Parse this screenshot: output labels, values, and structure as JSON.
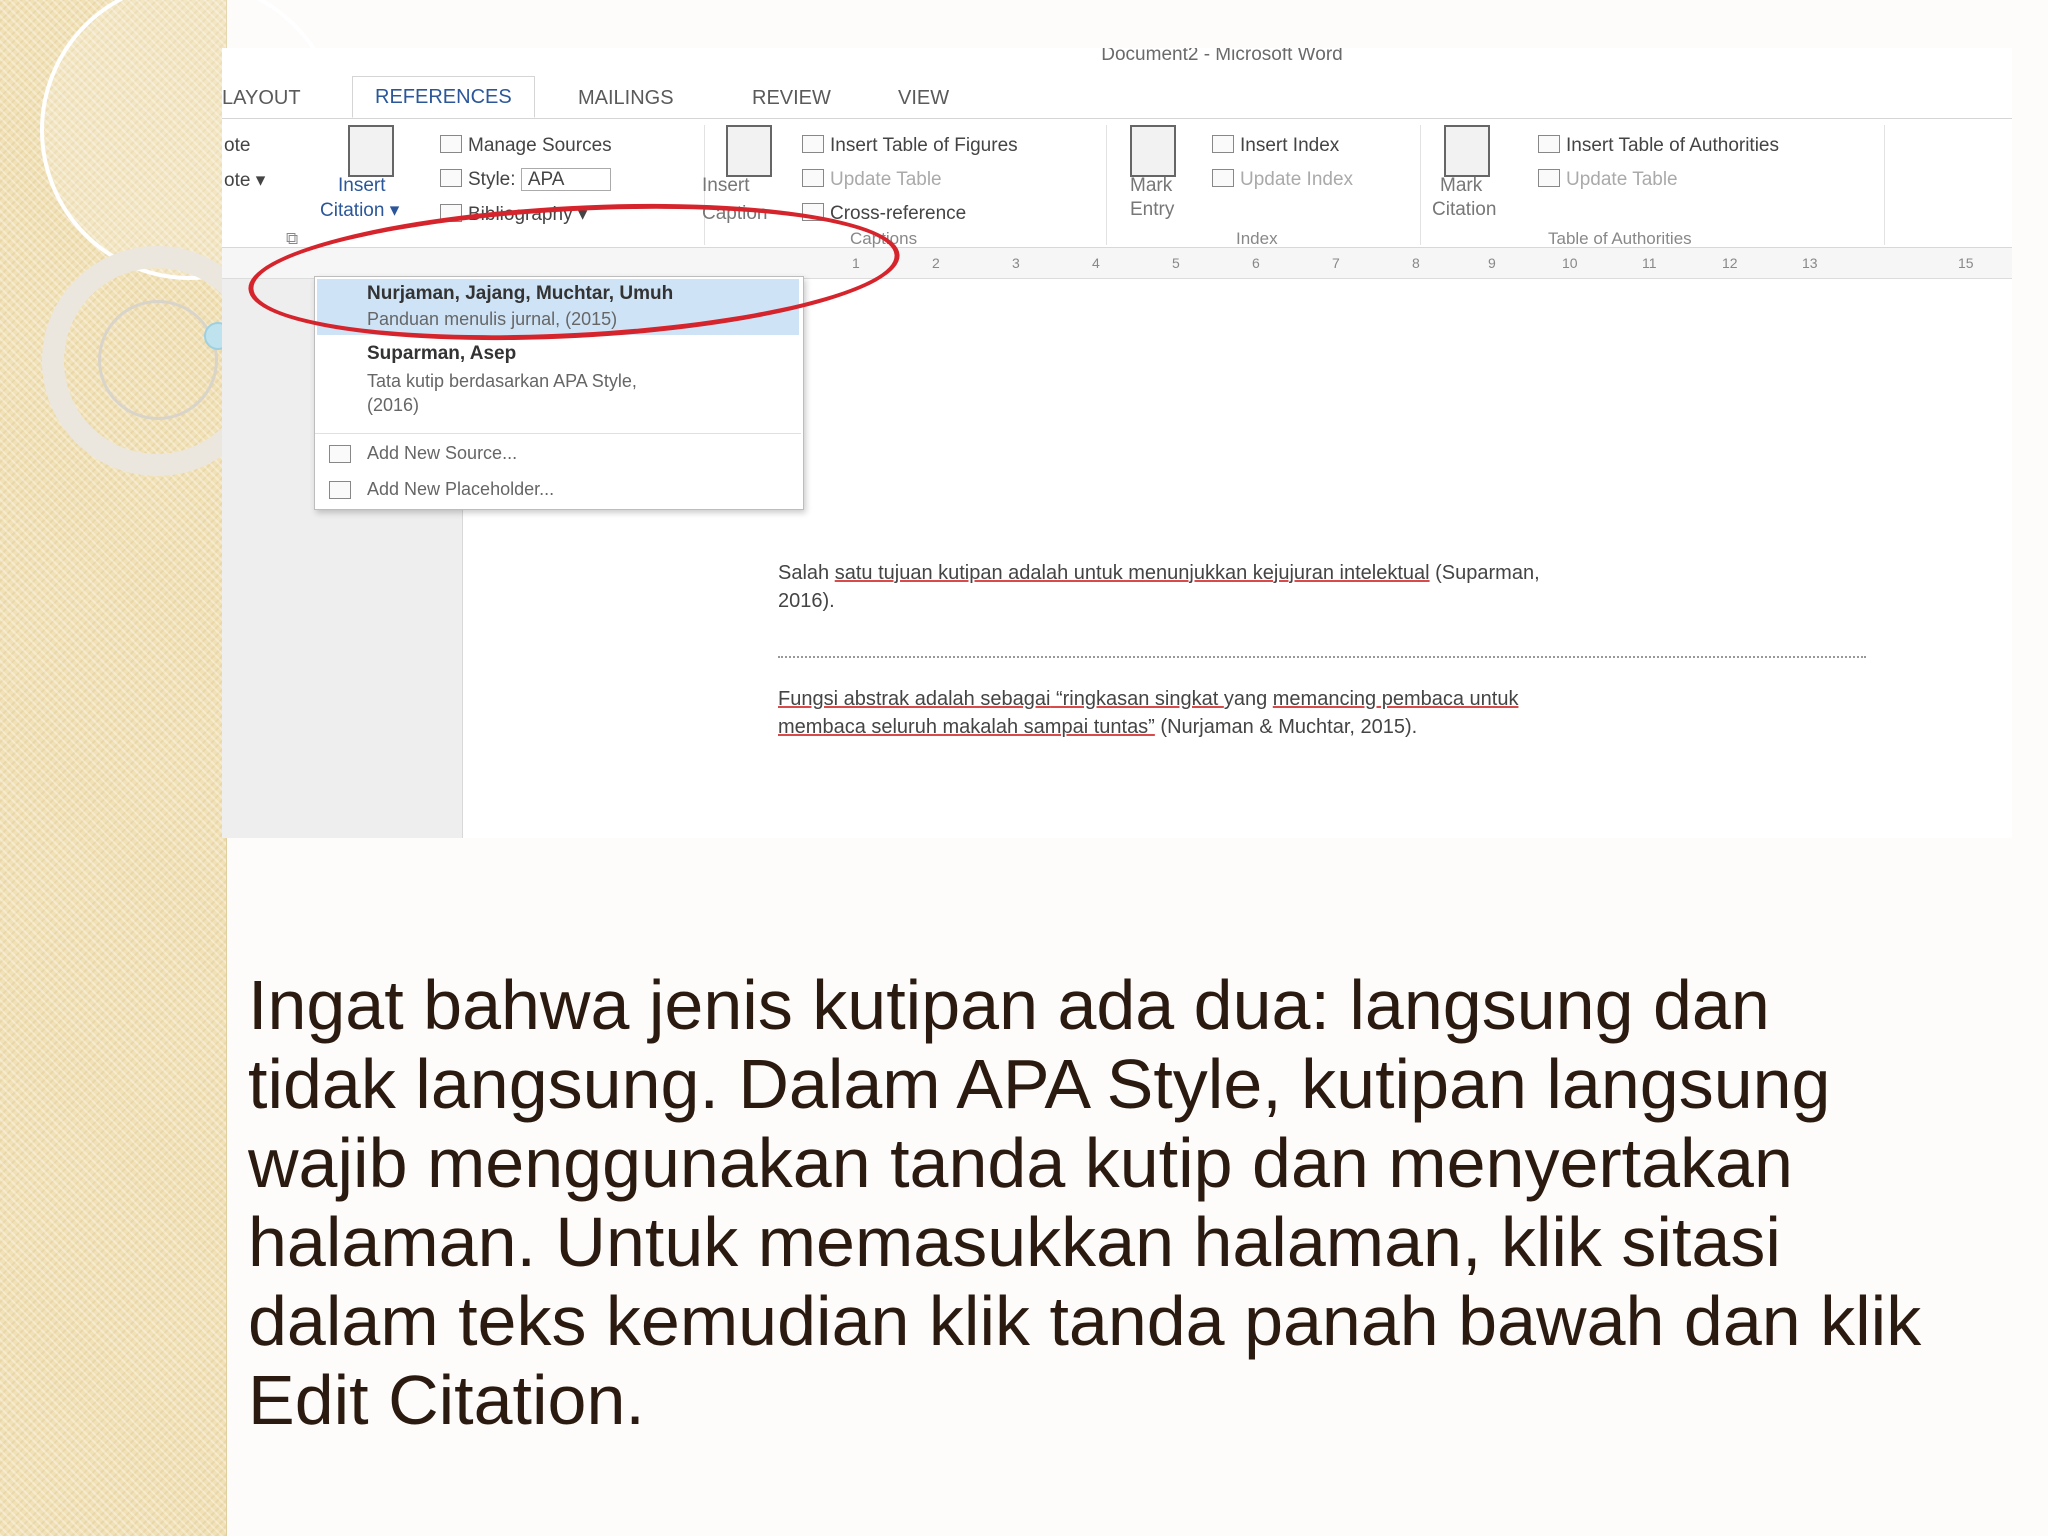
{
  "window": {
    "title": "Document2 - Microsoft Word"
  },
  "ribbon_tabs": [
    {
      "label": "LAYOUT"
    },
    {
      "label": "REFERENCES",
      "active": true
    },
    {
      "label": "MAILINGS"
    },
    {
      "label": "REVIEW"
    },
    {
      "label": "VIEW"
    }
  ],
  "ribbon": {
    "footnotes_partial": [
      "ote",
      "ote  ▾"
    ],
    "insert_citation": [
      "Insert",
      "Citation ▾"
    ],
    "manage_sources": "Manage Sources",
    "style_label": "Style:",
    "style_value": "APA",
    "bibliography": "Bibliography ▾",
    "captions": {
      "insert_caption": [
        "Insert",
        "Caption"
      ],
      "insert_table_of_figures": "Insert Table of Figures",
      "update_table": "Update Table",
      "cross_reference": "Cross-reference",
      "group_label": "Captions"
    },
    "index": {
      "mark_entry": [
        "Mark",
        "Entry"
      ],
      "insert_index": "Insert Index",
      "update_index": "Update Index",
      "group_label": "Index"
    },
    "authorities": {
      "mark_citation": [
        "Mark",
        "Citation"
      ],
      "insert_table_of_authorities": "Insert Table of Authorities",
      "update_table": "Update Table",
      "group_label": "Table of Authorities"
    }
  },
  "ruler_ticks": [
    "1",
    "2",
    "3",
    "4",
    "5",
    "6",
    "7",
    "8",
    "9",
    "10",
    "11",
    "12",
    "13",
    "15"
  ],
  "citation_menu": {
    "sources": [
      {
        "author": "Nurjaman, Jajang, Muchtar, Umuh",
        "detail": "Panduan menulis jurnal, (2015)",
        "highlighted": true
      },
      {
        "author": "Suparman, Asep",
        "detail": "Tata kutip berdasarkan APA Style,",
        "detail2": "(2016)"
      }
    ],
    "add_new_source": "Add New Source...",
    "add_new_placeholder": "Add New Placeholder..."
  },
  "document": {
    "para1_line1_a": "Salah ",
    "para1_line1_b": "satu tujuan kutipan adalah untuk menunjukkan kejujuran intelektual",
    "para1_line1_c": " (Suparman,",
    "para1_line2": "2016).",
    "para2_line1_a": "Fungsi abstrak adalah sebagai",
    "para2_line1_b": " “ringkasan singkat ",
    "para2_line1_c": "yang ",
    "para2_line1_d": "memancing pembaca untuk",
    "para2_line2_a": "membaca seluruh makalah sampai tuntas”",
    "para2_line2_b": " (Nurjaman & Muchtar, 2015)."
  },
  "caption_lines": [
    "Ingat bahwa jenis kutipan ada dua: langsung dan",
    "tidak langsung. Dalam APA Style, kutipan langsung",
    "wajib menggunakan tanda kutip dan menyertakan",
    "halaman. Untuk memasukkan halaman, klik sitasi",
    "dalam teks kemudian klik tanda panah bawah dan klik",
    "Edit Citation."
  ],
  "colors": {
    "highlight_oval": "#d5242b",
    "active_tab": "#2b579a",
    "caption_text": "#2b1a10",
    "strip": "#f1e1b6"
  }
}
